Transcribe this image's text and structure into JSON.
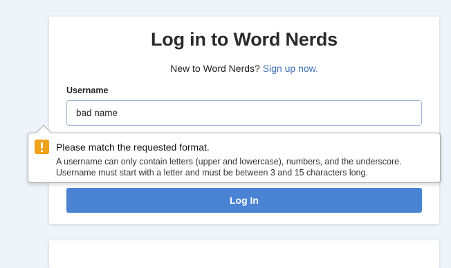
{
  "colors": {
    "page_bg": "#eef4fa",
    "accent": "#4a83d4",
    "link": "#3b6fb6",
    "warning": "#f0a11a"
  },
  "login": {
    "title": "Log in to Word Nerds",
    "signup_prefix": "New to Word Nerds? ",
    "signup_link": "Sign up now.",
    "username_label": "Username",
    "username_value": "bad name",
    "submit_label": "Log In"
  },
  "validation_tooltip": {
    "icon": "warning-icon",
    "heading": "Please match the requested format.",
    "line1": "A username can only contain letters (upper and lowercase), numbers, and the underscore.",
    "line2": "Username must start with a letter and must be between 3 and 15 characters long."
  }
}
